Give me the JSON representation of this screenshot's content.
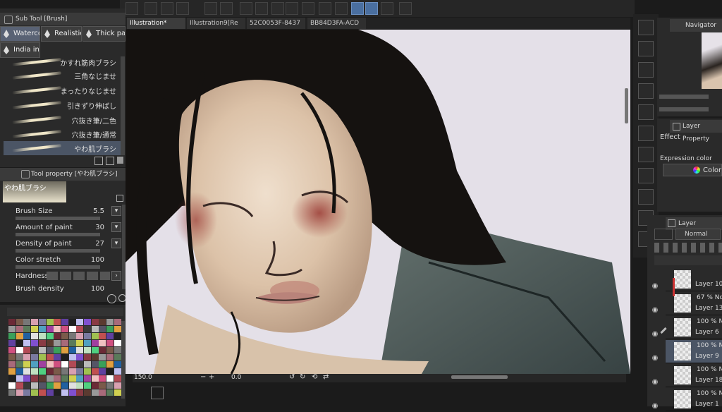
{
  "toolbar": {
    "icons": [
      "app-logo-icon",
      "new-file-icon",
      "open-folder-icon",
      "save-icon",
      "undo-icon",
      "redo-icon",
      "loading-icon",
      "clear-icon",
      "fill-icon",
      "transform-icon",
      "ruler-icon",
      "color-swap-icon",
      "frame-icon",
      "pen-icon",
      "brush-icon",
      "pen-line-icon",
      "help-icon"
    ]
  },
  "subtool": {
    "header": "Sub Tool [Brush]",
    "tabs": [
      "Waterco",
      "Realistic",
      "Thick pa",
      "India ink"
    ],
    "brushes": [
      "かすれ筋肉ブラシ",
      "三角なじませ",
      "まったりなじませ",
      "引きずり伸ばし",
      "穴抜き筆/二色",
      "穴抜き筆/通常",
      "やわ肌ブラシ"
    ]
  },
  "tool_property": {
    "header": "Tool property [やわ肌ブラシ]",
    "brush_name": "やわ肌ブラシ",
    "brush_size_label": "Brush Size",
    "brush_size_value": "5.5",
    "amount_label": "Amount of paint",
    "amount_value": "30",
    "density_label": "Density of paint",
    "density_value": "27",
    "stretch_label": "Color stretch",
    "stretch_value": "100",
    "hardness_label": "Hardness",
    "brush_density_label": "Brush density",
    "brush_density_value": "100"
  },
  "tabs": [
    "Illustration*",
    "Illustration9[Re",
    "52C0053F-8437",
    "BB84D3FA-ACD"
  ],
  "status": {
    "zoom": "150.0",
    "angle": "0.0"
  },
  "navigator": {
    "header": "Navigator"
  },
  "layer_property": {
    "header": "Layer Property",
    "effect_label": "Effect",
    "expression_label": "Expression color",
    "color_label": "Color"
  },
  "layers_panel": {
    "header": "Layer",
    "blend_mode": "Normal",
    "items": [
      {
        "opacity": "",
        "name": "Layer 10"
      },
      {
        "opacity": "67 % No",
        "name": "Layer 13"
      },
      {
        "opacity": "100 % No",
        "name": "Layer 6"
      },
      {
        "opacity": "100 % No",
        "name": "Layer 9"
      },
      {
        "opacity": "100 % No",
        "name": "Layer 18"
      },
      {
        "opacity": "100 % No",
        "name": "Layer 1"
      }
    ]
  },
  "colors": {
    "accent": "#4a6fa0",
    "paper": "#e4e0e8",
    "hair": "#151210",
    "skin": "#e7d3bf",
    "teal_cloth": "#4a5a58"
  }
}
